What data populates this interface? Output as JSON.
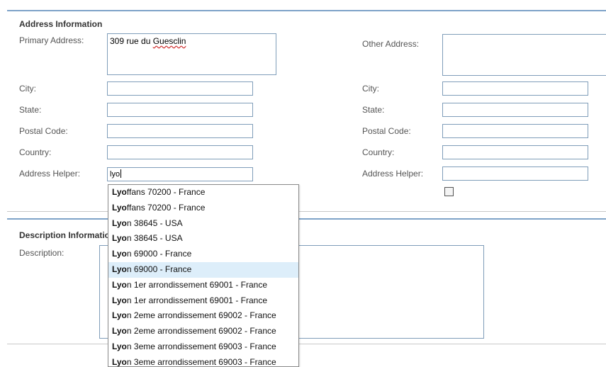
{
  "address_section": {
    "title": "Address Information",
    "primary": {
      "label": "Primary Address:",
      "value_plain": "309 rue du ",
      "value_flagged": "Guesclin"
    },
    "other_label": "Other Address:",
    "left_fields": {
      "city_label": "City:",
      "state_label": "State:",
      "postal_label": "Postal Code:",
      "country_label": "Country:",
      "helper_label": "Address Helper:",
      "helper_value": "lyo"
    },
    "right_fields": {
      "city_label": "City:",
      "state_label": "State:",
      "postal_label": "Postal Code:",
      "country_label": "Country:",
      "helper_label": "Address Helper:"
    }
  },
  "description_section": {
    "title": "Description Information",
    "description_label": "Description:"
  },
  "autocomplete": {
    "highlighted_index": 5,
    "options": [
      {
        "match": "Lyo",
        "rest": "ffans 70200 - France"
      },
      {
        "match": "Lyo",
        "rest": "ffans 70200 - France"
      },
      {
        "match": "Lyo",
        "rest": "n 38645 - USA"
      },
      {
        "match": "Lyo",
        "rest": "n 38645 - USA"
      },
      {
        "match": "Lyo",
        "rest": "n 69000 - France"
      },
      {
        "match": "Lyo",
        "rest": "n 69000 - France"
      },
      {
        "match": "Lyo",
        "rest": "n 1er arrondissement 69001 - France"
      },
      {
        "match": "Lyo",
        "rest": "n 1er arrondissement 69001 - France"
      },
      {
        "match": "Lyo",
        "rest": "n 2eme arrondissement 69002 - France"
      },
      {
        "match": "Lyo",
        "rest": "n 2eme arrondissement 69002 - France"
      },
      {
        "match": "Lyo",
        "rest": "n 3eme arrondissement 69003 - France"
      },
      {
        "match": "Lyo",
        "rest": "n 3eme arrondissement 69003 - France"
      }
    ]
  }
}
